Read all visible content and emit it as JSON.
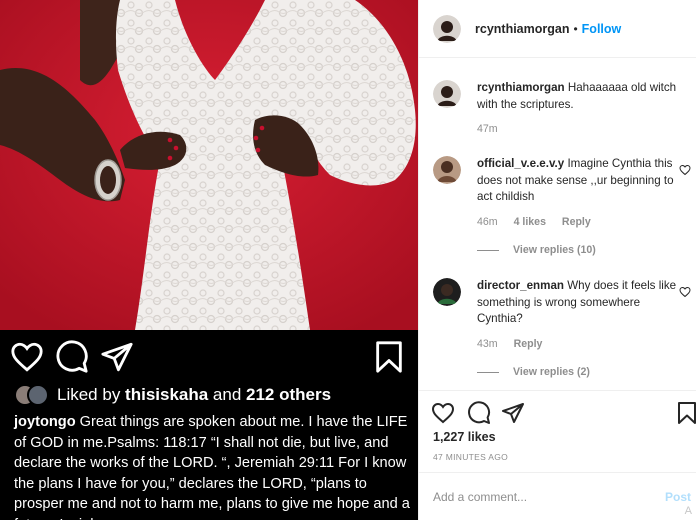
{
  "post": {
    "image_alt": "Woman in white lace dress with hands on hips against red background",
    "embedded_screenshot": {
      "liked_prefix": "Liked by ",
      "liked_user": "thisiskaha",
      "liked_mid": " and ",
      "liked_count": "212 others",
      "caption_user": "joytongo",
      "caption_text": " Great things are spoken about me. I have the LIFE of GOD  in me.Psalms: 118:17 “I shall not die, but live, and declare the works of the LORD. “, Jeremiah 29:11 For I know the plans I have for you,” declares the LORD, “plans to prosper me and not to harm me, plans to give me hope and a future. Isaiah"
    }
  },
  "header": {
    "username": "rcynthiamorgan",
    "separator": "•",
    "follow_label": "Follow"
  },
  "comments": [
    {
      "username": "rcynthiamorgan",
      "text": " Hahaaaaaa old witch with the scriptures.",
      "time": "47m"
    },
    {
      "username": "official_v.e.e.v.y",
      "text": " Imagine Cynthia this does not make sense ,,ur beginning to act childish",
      "time": "46m",
      "likes": "4 likes",
      "reply": "Reply",
      "view_replies": "View replies (10)"
    },
    {
      "username": "director_enman",
      "text": " Why does it feels like something is wrong somewhere Cynthia?",
      "time": "43m",
      "reply": "Reply",
      "view_replies": "View replies (2)"
    }
  ],
  "footer": {
    "likes": "1,227 likes",
    "time_ago": "47 MINUTES AGO",
    "add_comment_placeholder": "Add a comment...",
    "post_label": "Post",
    "corner_glyph": "A"
  },
  "colors": {
    "accent": "#0095f6",
    "photo_bg": "#c4172b",
    "muted": "#8e8e8e"
  }
}
